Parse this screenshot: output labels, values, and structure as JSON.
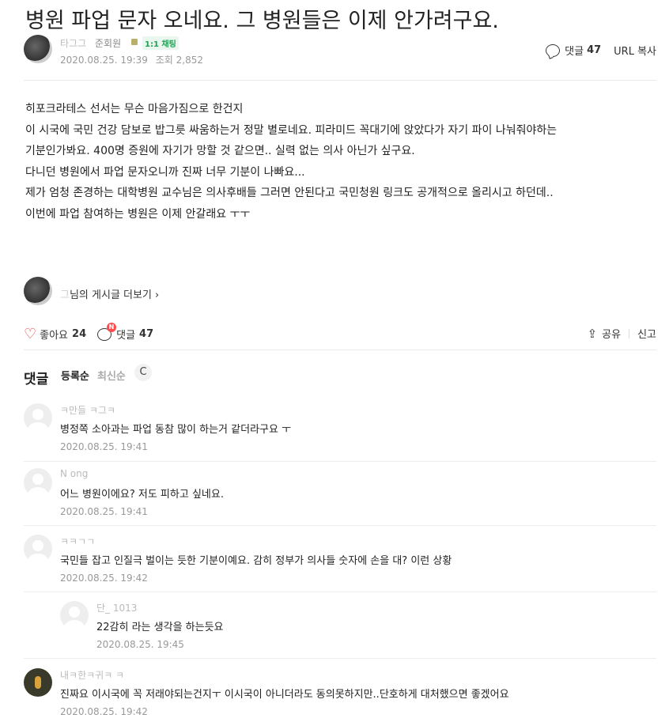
{
  "post": {
    "title": "병원 파업 문자 오네요. 그 병원들은 이제 안가려구요.",
    "author_name": "타그그",
    "author_grade": "준회원",
    "chat_badge": "1:1 채팅",
    "date": "2020.08.25. 19:39",
    "views": "조회 2,852",
    "comments_label": "댓글",
    "comments_count": "47",
    "url_copy": "URL 복사",
    "body": [
      "히포크라테스 선서는 무슨 마음가짐으로 한건지",
      "이 시국에 국민 건강 담보로 밥그릇 싸움하는거 정말 별로네요. 피라미드 꼭대기에 앉았다가 자기 파이 나눠줘야하는",
      "기분인가봐요. 400명 증원에 자기가 망할 것 같으면.. 실력 없는 의사 아닌가 싶구요.",
      "다니던 병원에서 파업 문자오니까 진짜 너무 기분이 나빠요...",
      "제가 엄청 존경하는 대학병원 교수님은 의사후배들 그러면 안된다고  국민청원 링크도 공개적으로 올리시고 하던데..",
      "이번에 파업 참여하는 병원은 이제 안갈래요 ㅜㅜ"
    ]
  },
  "more_posts": {
    "name": "그",
    "suffix": "님의 게시글 더보기 ›"
  },
  "actions": {
    "like_label": "좋아요",
    "like_count": "24",
    "new_badge": "N",
    "comment_label": "댓글",
    "comment_count": "47",
    "share_label": "공유",
    "report_label": "신고"
  },
  "comments_header": {
    "title": "댓글",
    "sort_registered": "등록순",
    "sort_latest": "최신순",
    "refresh_icon": "C"
  },
  "comments": [
    {
      "name": "ㅋ만들 ㅋ그ㅋ",
      "text": "병정쪽 소아과는 파업 동참 많이 하는거 같더라구요 ㅜ",
      "date": "2020.08.25. 19:41"
    },
    {
      "name": "N ong",
      "text": "어느 병원이에요? 저도 피하고 싶네요.",
      "date": "2020.08.25. 19:41"
    },
    {
      "name": "ㅋㅋㄱㄱ",
      "text": "국민들 잡고 인질극 벌이는 듯한 기분이예요. 감히 정부가 의사들 숫자에 손을 대? 이런 상황",
      "date": "2020.08.25. 19:42"
    },
    {
      "name": "단_ 1013",
      "text": "22감히 라는 생각을 하는듯요",
      "date": "2020.08.25. 19:45"
    },
    {
      "name": "내ㅋ한ㅋ귀ㅋ ㅋ",
      "text": "진짜요 이시국에 꼭 저래야되는건지ㅜ 이시국이 아니더라도 동의못하지만..단호하게 대처했으면 좋겠어요",
      "date": "2020.08.25. 19:42"
    }
  ],
  "colors": {
    "like_heart": "#e53c3c",
    "chat_badge": "#1fa352",
    "new_badge": "#ff4b4b"
  },
  "icons": [
    "comment-icon",
    "heart-icon",
    "share-icon",
    "refresh-icon",
    "grade-icon"
  ]
}
